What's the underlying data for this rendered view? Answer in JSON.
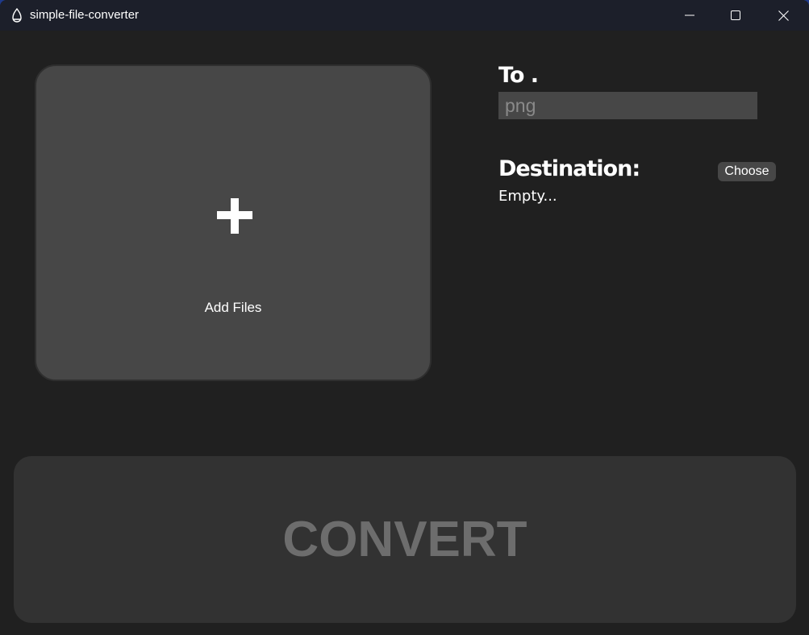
{
  "window": {
    "title": "simple-file-converter",
    "icon": "app-flame-icon",
    "controls": [
      "minimize-icon",
      "maximize-icon",
      "close-icon"
    ]
  },
  "dropzone": {
    "icon": "plus-icon",
    "label": "Add Files"
  },
  "format": {
    "label": "To .",
    "placeholder": "png",
    "value": ""
  },
  "destination": {
    "label": "Destination:",
    "choose_label": "Choose",
    "value": "Empty..."
  },
  "convert": {
    "label": "CONVERT"
  },
  "colors": {
    "background": "#202020",
    "titlebar": "#1c1f2a",
    "panel": "#474747",
    "convert_bg": "#323232",
    "convert_text": "#6d6d6d",
    "text": "#ffffff"
  }
}
